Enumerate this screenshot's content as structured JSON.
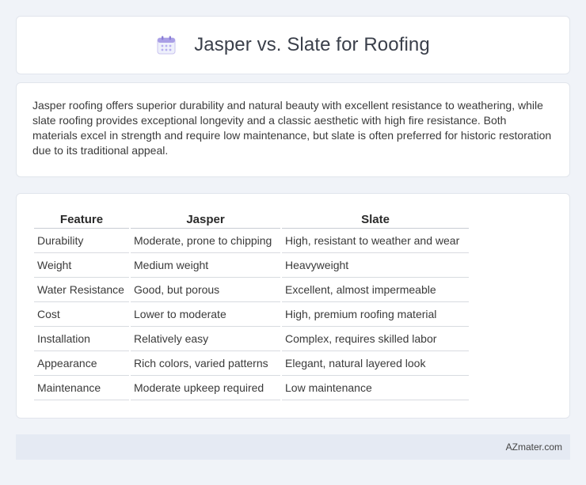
{
  "header": {
    "title": "Jasper vs. Slate for Roofing"
  },
  "summary": {
    "text": "Jasper roofing offers superior durability and natural beauty with excellent resistance to weathering, while slate roofing provides exceptional longevity and a classic aesthetic with high fire resistance. Both materials excel in strength and require low maintenance, but slate is often preferred for historic restoration due to its traditional appeal."
  },
  "table": {
    "headers": [
      "Feature",
      "Jasper",
      "Slate"
    ],
    "rows": [
      [
        "Durability",
        "Moderate, prone to chipping",
        "High, resistant to weather and wear"
      ],
      [
        "Weight",
        "Medium weight",
        "Heavyweight"
      ],
      [
        "Water Resistance",
        "Good, but porous",
        "Excellent, almost impermeable"
      ],
      [
        "Cost",
        "Lower to moderate",
        "High, premium roofing material"
      ],
      [
        "Installation",
        "Relatively easy",
        "Complex, requires skilled labor"
      ],
      [
        "Appearance",
        "Rich colors, varied patterns",
        "Elegant, natural layered look"
      ],
      [
        "Maintenance",
        "Moderate upkeep required",
        "Low maintenance"
      ]
    ]
  },
  "footer": {
    "brand": "AZmater.com"
  },
  "colors": {
    "icon_accent": "#8b7fd6",
    "footer_bg": "#e5eaf3"
  },
  "icons": {
    "header": "calendar-icon"
  }
}
